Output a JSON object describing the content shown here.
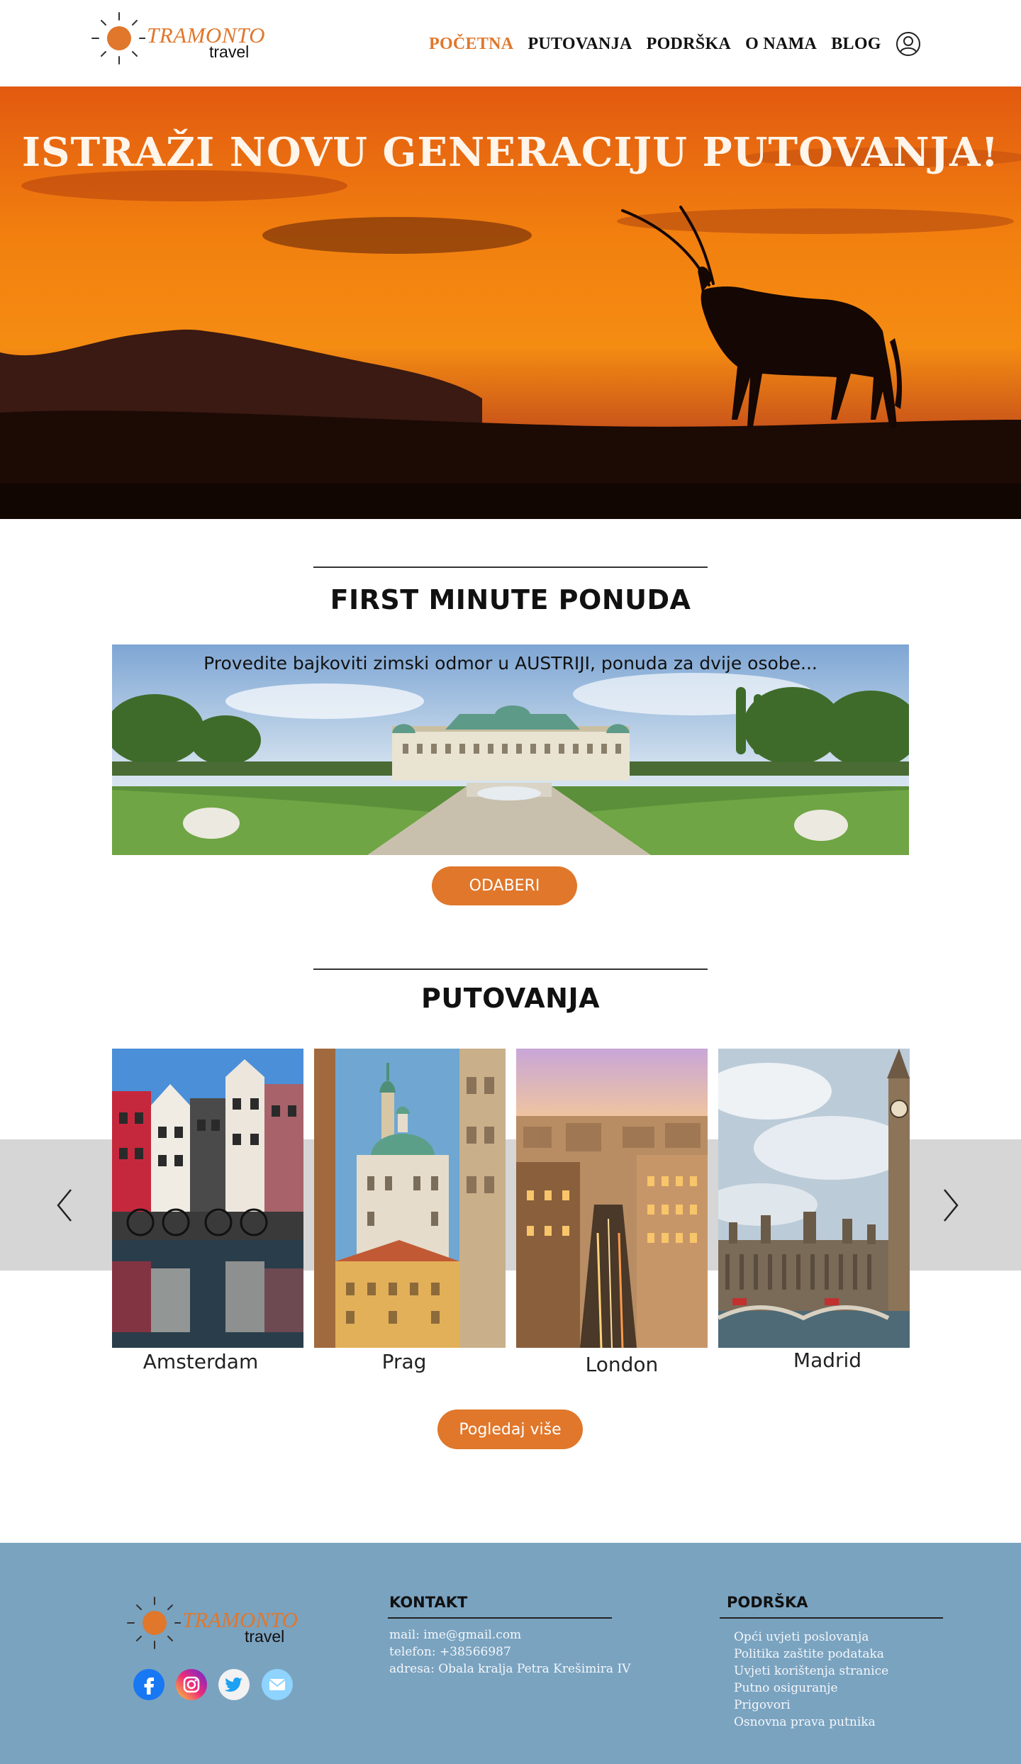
{
  "header": {
    "logo_brand": "TRAMONTO",
    "logo_sub": "travel",
    "nav": [
      "POČETNA",
      "PUTOVANJA",
      "PODRŠKA",
      "O NAMA",
      "BLOG"
    ],
    "active_color": "#e0772b"
  },
  "hero": {
    "title": "ISTRAŽI NOVU GENERACIJU PUTOVANJA!"
  },
  "first_minute": {
    "title": "FIRST MINUTE PONUDA",
    "offer_text": "Provedite bajkoviti zimski odmor u AUSTRIJI, ponuda za dvije osobe...",
    "button": "ODABERI"
  },
  "trips": {
    "title": "PUTOVANJA",
    "cards": [
      {
        "label": "Amsterdam"
      },
      {
        "label": "Prag"
      },
      {
        "label": "London"
      },
      {
        "label": "Madrid"
      }
    ],
    "button": "Pogledaj više"
  },
  "footer": {
    "logo_brand": "TRAMONTO",
    "logo_sub": "travel",
    "contact_title": "KONTAKT",
    "contact_mail": "mail: ime@gmail.com",
    "contact_phone": "telefon: +38566987",
    "contact_address": "adresa: Obala kralja Petra Krešimira IV",
    "support_title": "PODRŠKA",
    "support_links": [
      "Opći uvjeti poslovanja",
      "Politika zaštite podataka",
      "Uvjeti korištenja stranice",
      "Putno osiguranje",
      "Prigovori",
      "Osnovna prava putnika"
    ],
    "background": "#7aa3c0"
  },
  "colors": {
    "accent": "#e0772b"
  }
}
